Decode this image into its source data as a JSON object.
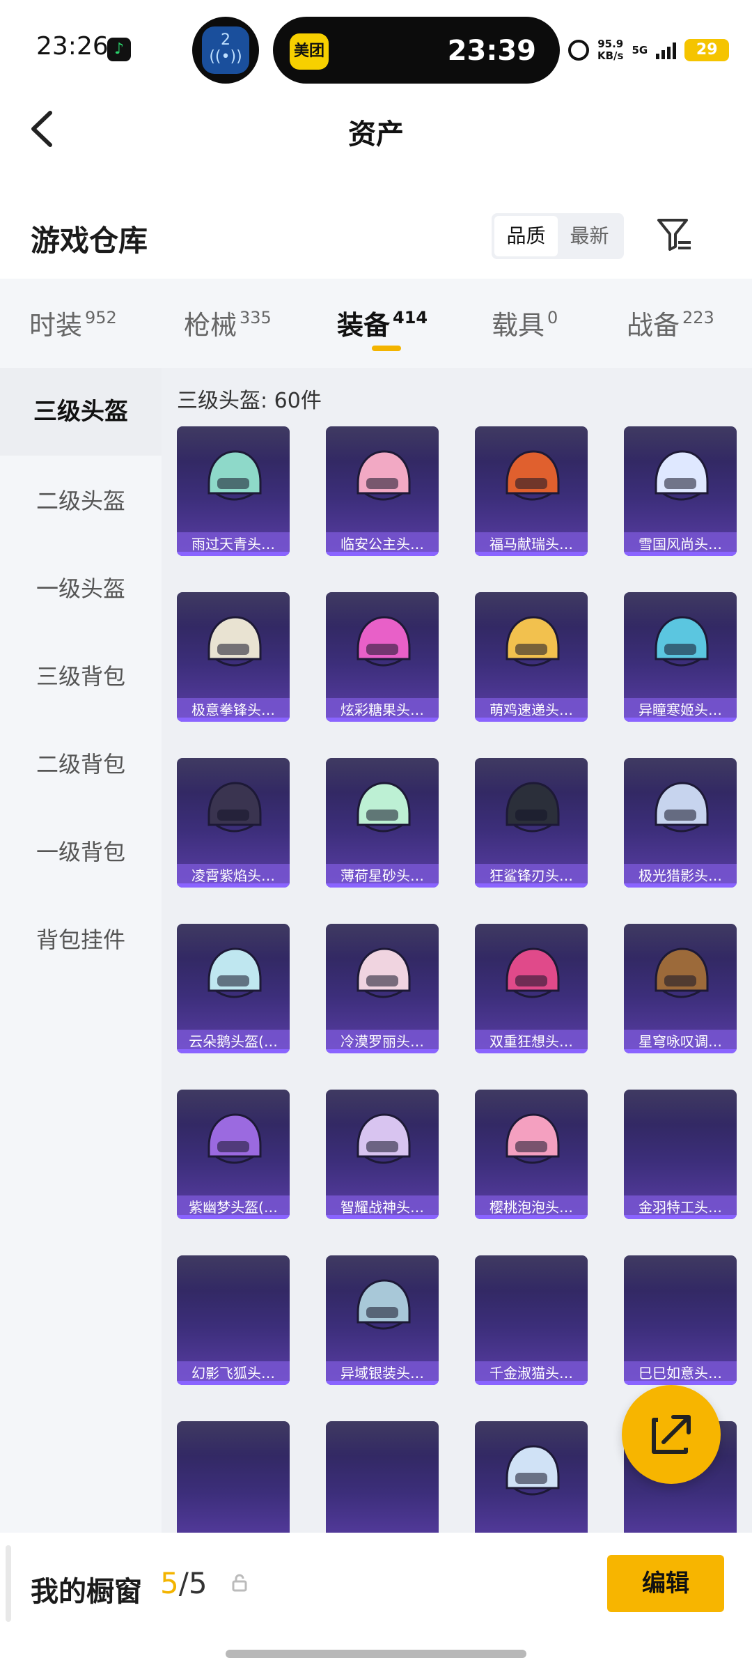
{
  "status_bar": {
    "time": "23:26",
    "cast_badge": "2",
    "island_app": "美团",
    "island_time": "23:39",
    "speed_value": "95.9",
    "speed_unit": "KB/s",
    "network": "5G",
    "battery": "29"
  },
  "header": {
    "title": "资产"
  },
  "repo": {
    "title": "游戏仓库",
    "sort_options": [
      "品质",
      "最新"
    ],
    "sort_selected": "品质"
  },
  "tabs": [
    {
      "label": "时装",
      "count": "952"
    },
    {
      "label": "枪械",
      "count": "335"
    },
    {
      "label": "装备",
      "count": "414"
    },
    {
      "label": "载具",
      "count": "0"
    },
    {
      "label": "战备",
      "count": "223"
    }
  ],
  "active_tab": "装备",
  "sidebar": [
    {
      "label": "三级头盔"
    },
    {
      "label": "二级头盔"
    },
    {
      "label": "一级头盔"
    },
    {
      "label": "三级背包"
    },
    {
      "label": "二级背包"
    },
    {
      "label": "一级背包"
    },
    {
      "label": "背包挂件"
    }
  ],
  "active_category": "三级头盔",
  "grid": {
    "heading": "三级头盔: 60件",
    "items": [
      {
        "name": "雨过天青头…",
        "color": "#8ed9c9"
      },
      {
        "name": "临安公主头…",
        "color": "#f2a9c4"
      },
      {
        "name": "福马献瑞头…",
        "color": "#e0602e"
      },
      {
        "name": "雪国风尚头…",
        "color": "#dfe8ff"
      },
      {
        "name": "极意拳锋头…",
        "color": "#e9e3d2"
      },
      {
        "name": "炫彩糖果头…",
        "color": "#e860c8"
      },
      {
        "name": "萌鸡速递头…",
        "color": "#f2c14e"
      },
      {
        "name": "异瞳寒姬头…",
        "color": "#5bc6e0"
      },
      {
        "name": "凌霄紫焰头…",
        "color": "#3a3450"
      },
      {
        "name": "薄荷星砂头…",
        "color": "#bdf0d4"
      },
      {
        "name": "狂鲨锋刃头…",
        "color": "#2b2f3a"
      },
      {
        "name": "极光猎影头…",
        "color": "#c7d4ee"
      },
      {
        "name": "云朵鹅头盔(…",
        "color": "#bfe7f0"
      },
      {
        "name": "冷漠罗丽头…",
        "color": "#f0d4e0"
      },
      {
        "name": "双重狂想头…",
        "color": "#e04a8a"
      },
      {
        "name": "星穹咏叹调…",
        "color": "#9c6a3a"
      },
      {
        "name": "紫幽梦头盔(…",
        "color": "#9b6ae0"
      },
      {
        "name": "智耀战神头…",
        "color": "#d8c4f0"
      },
      {
        "name": "樱桃泡泡头…",
        "color": "#f4a0c0"
      },
      {
        "name": "金羽特工头…",
        "color": ""
      },
      {
        "name": "幻影飞狐头…",
        "color": ""
      },
      {
        "name": "异域银装头…",
        "color": "#a8c8d8"
      },
      {
        "name": "千金淑猫头…",
        "color": ""
      },
      {
        "name": "巳巳如意头…",
        "color": ""
      },
      {
        "name": "",
        "color": ""
      },
      {
        "name": "",
        "color": ""
      },
      {
        "name": "",
        "color": "#d0e2f6"
      },
      {
        "name": "",
        "color": ""
      }
    ]
  },
  "showcase": {
    "title": "我的橱窗",
    "current": "5",
    "separator": "/",
    "total": "5",
    "edit_label": "编辑"
  },
  "colors": {
    "accent": "#f7b500",
    "card_bg": "#3c2e7a",
    "label_bg": "#7856d2"
  }
}
